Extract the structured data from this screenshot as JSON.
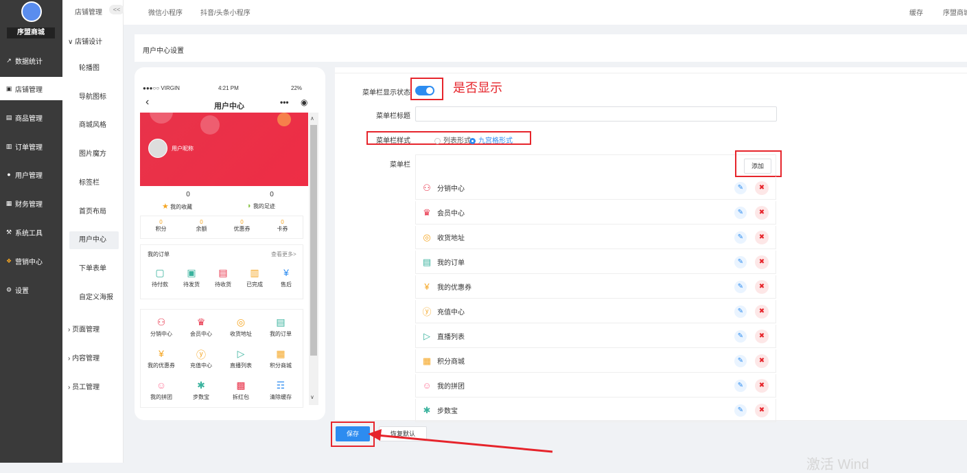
{
  "brand": {
    "name": "序盟商城"
  },
  "left_nav": [
    {
      "label": "数据统计",
      "icon": "chart-icon"
    },
    {
      "label": "店铺管理",
      "icon": "store-icon",
      "active": true
    },
    {
      "label": "商品管理",
      "icon": "goods-icon"
    },
    {
      "label": "订单管理",
      "icon": "order-icon"
    },
    {
      "label": "用户管理",
      "icon": "user-icon"
    },
    {
      "label": "财务管理",
      "icon": "finance-icon"
    },
    {
      "label": "系统工具",
      "icon": "wrench-icon"
    },
    {
      "label": "营销中心",
      "icon": "marketing-icon"
    },
    {
      "label": "设置",
      "icon": "gear-icon"
    }
  ],
  "sub_nav": {
    "header": "店铺管理",
    "collapse": "<<",
    "group_store_design": "店铺设计",
    "items": [
      "轮播图",
      "导航图标",
      "商城风格",
      "图片魔方",
      "标签栏",
      "首页布局",
      "用户中心",
      "下单表单",
      "自定义海报"
    ],
    "groups": [
      "页面管理",
      "内容管理",
      "员工管理"
    ]
  },
  "top_bar": {
    "tabs": [
      "微信小程序",
      "抖音/头条小程序"
    ],
    "right": [
      "缓存",
      "序盟商城"
    ]
  },
  "breadcrumb": "用户中心设置",
  "phone": {
    "carrier": "●●●○○ VIRGIN",
    "time": "4:21 PM",
    "battery": "22%",
    "title": "用户中心",
    "nickname": "用户昵称",
    "favorites": {
      "count": "0",
      "label": "我的收藏"
    },
    "footprints": {
      "count": "0",
      "label": "我的足迹"
    },
    "assets": [
      {
        "value": "0",
        "label": "积分"
      },
      {
        "value": "0",
        "label": "余额"
      },
      {
        "value": "0",
        "label": "优惠券"
      },
      {
        "value": "0",
        "label": "卡券"
      }
    ],
    "orders": {
      "title": "我的订单",
      "more": "查看更多>",
      "items": [
        "待付款",
        "待发货",
        "待收货",
        "已完成",
        "售后"
      ]
    },
    "grid": [
      "分销中心",
      "会员中心",
      "收货地址",
      "我的订单",
      "我的优惠券",
      "充值中心",
      "直播列表",
      "积分商城",
      "我的拼团",
      "步数宝",
      "拆红包",
      "清除缓存"
    ]
  },
  "settings": {
    "menu_visible_label": "菜单栏显示状态",
    "annotation": "是否显示",
    "menu_title_label": "菜单栏标题",
    "menu_title_value": "",
    "menu_style_label": "菜单栏样式",
    "style_options": [
      {
        "label": "列表形式",
        "selected": false
      },
      {
        "label": "九宫格形式",
        "selected": true
      }
    ],
    "menu_label": "菜单栏",
    "add_button": "添加",
    "menu_items": [
      "分销中心",
      "会员中心",
      "收货地址",
      "我的订单",
      "我的优惠券",
      "充值中心",
      "直播列表",
      "积分商城",
      "我的拼团",
      "步数宝"
    ],
    "save": "保存",
    "reset": "恢复默认"
  },
  "watermark": "激活 Wind",
  "colors": {
    "accent": "#2d8cf0",
    "annotation": "#e6242b",
    "banner": "#e8334a",
    "sidebar": "#3a3a3a"
  }
}
